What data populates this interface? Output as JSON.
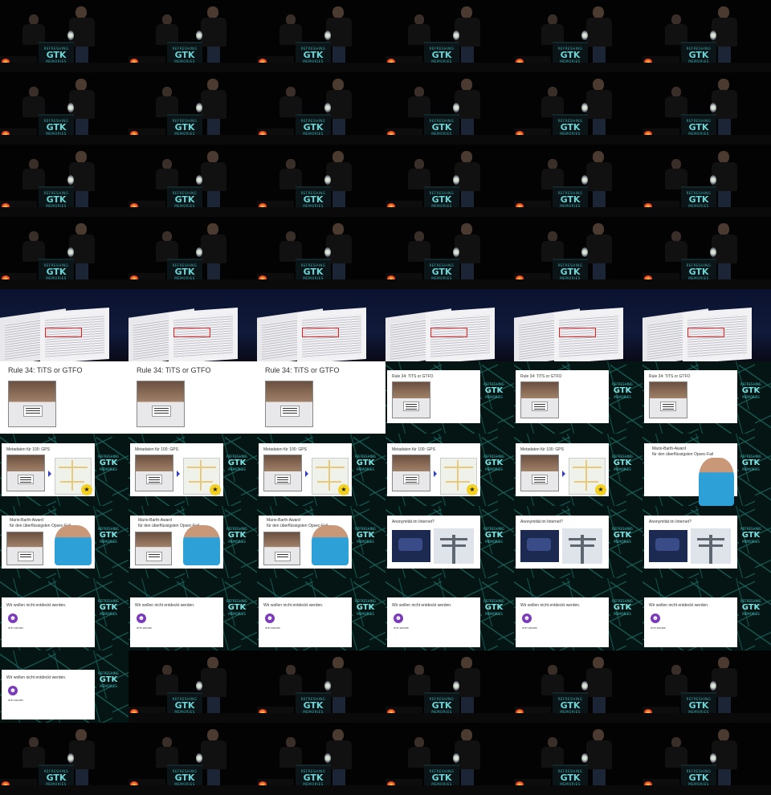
{
  "grid": {
    "columns": 6,
    "rows": 11,
    "frame_kinds": [
      "stage",
      "stage",
      "stage",
      "stage",
      "stage",
      "stage",
      "stage",
      "stage",
      "stage",
      "stage",
      "stage",
      "stage",
      "stage",
      "stage",
      "stage",
      "stage",
      "stage",
      "stage",
      "stage",
      "stage",
      "stage",
      "stage",
      "stage",
      "stage",
      "book",
      "book",
      "book",
      "book",
      "book",
      "book",
      "rule34-full",
      "rule34-full",
      "rule34-full",
      "rule34-small",
      "rule34-small",
      "rule34-small",
      "metadata",
      "metadata",
      "metadata",
      "metadata",
      "metadata",
      "award-full",
      "award",
      "award",
      "award",
      "anon",
      "anon",
      "anon",
      "hidden",
      "hidden",
      "hidden",
      "hidden",
      "hidden",
      "hidden",
      "hidden",
      "stage",
      "stage",
      "stage",
      "stage",
      "stage",
      "stage",
      "stage",
      "stage",
      "stage",
      "stage",
      "stage"
    ]
  },
  "stage_logo": {
    "line1": "REFRESHING",
    "line2": "GTK",
    "line3": "MEMORIES"
  },
  "slides": {
    "rule34_title": "Rule 34: TiTS or GTFO",
    "metadata_title": "Metadaten für 100: GPS",
    "award_title": "Mario-Barth-Award",
    "award_subtitle": "für den überflüssigsten Opsec-Fail",
    "anon_title": "Anonymität im Internet?",
    "hidden_title": "Wir wollen nicht entdeckt werden.",
    "hidden_ip": "IP 87.229.005"
  },
  "icons": {
    "devil": "devil-face-icon",
    "arrow": "arrow-right-icon",
    "map_badge": "police-badge-icon"
  },
  "colors": {
    "logo_teal": "#3fb2b8",
    "highlight_red": "#e02020",
    "network_bg": "#051514"
  }
}
